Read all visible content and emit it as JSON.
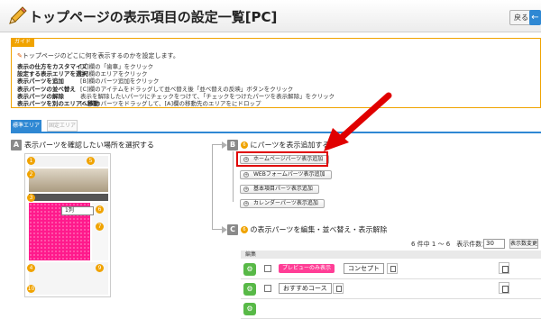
{
  "header": {
    "title": "トップページの表示項目の設定一覧[PC]",
    "back_label": "戻る",
    "back_icon": "arrow-left-icon"
  },
  "guide": {
    "tab": "ガイド",
    "intro": "トップページのどこに何を表示するのかを設定します。",
    "rows": [
      {
        "key": "表示の仕方をカスタマイズ",
        "value": "[C]欄の「歯車」をクリック"
      },
      {
        "key": "設定する表示エリアを選択",
        "value": "[A]欄のエリアをクリック"
      },
      {
        "key": "表示パーツを追加",
        "value": "[B]欄のパーツ追加をクリック"
      },
      {
        "key": "表示パーツの並べ替え",
        "value": "[C]欄のアイテムをドラッグして並べ替え後「並べ替えの反映」ボタンをクリック"
      },
      {
        "key": "表示パーツの解除",
        "value": "表示を解除したいパーツにチェックをつけて、「チェックをつけたパーツを表示解除」をクリック"
      },
      {
        "key": "表示パーツを別のエリアへ移動",
        "value": "[C]欄のパーツをドラッグして、[A]欄の移動先のエリアをにドロップ"
      }
    ]
  },
  "area_tabs": {
    "active": "標準エリア",
    "inactive": "固定エリア"
  },
  "section_a": {
    "badge": "A",
    "title": "表示パーツを確認したい場所を選択する",
    "preview_select": "1列",
    "numbers": [
      "1",
      "2",
      "3",
      "4",
      "5",
      "6",
      "7",
      "8",
      "9",
      "10"
    ]
  },
  "section_b": {
    "badge": "B",
    "dot": "6",
    "title": "にパーツを表示追加する",
    "buttons": [
      "ホームページパーツ表示追加",
      "WEBフォームパーツ表示追加",
      "基本項目パーツ表示追加",
      "カレンダーパーツ表示追加"
    ]
  },
  "section_c": {
    "badge": "C",
    "dot": "6",
    "title": "の表示パーツを編集・並べ替え・表示解除",
    "pager_text": "6 件中 1 ～ 6　表示件数：",
    "count_value": "30",
    "settings_label": "表示数変更",
    "table_header": "編集",
    "rows": [
      {
        "tag": "プレビューのみ表示",
        "part": "コンセプト"
      },
      {
        "tag": "",
        "part": "おすすめコース"
      },
      {
        "tag": "",
        "part": ""
      }
    ]
  },
  "colors": {
    "accent_blue": "#2f88d3",
    "guide_orange": "#f0a300",
    "highlight_red": "#e00000",
    "preview_pink": "#ff1a8c",
    "drag_green": "#58b947"
  }
}
